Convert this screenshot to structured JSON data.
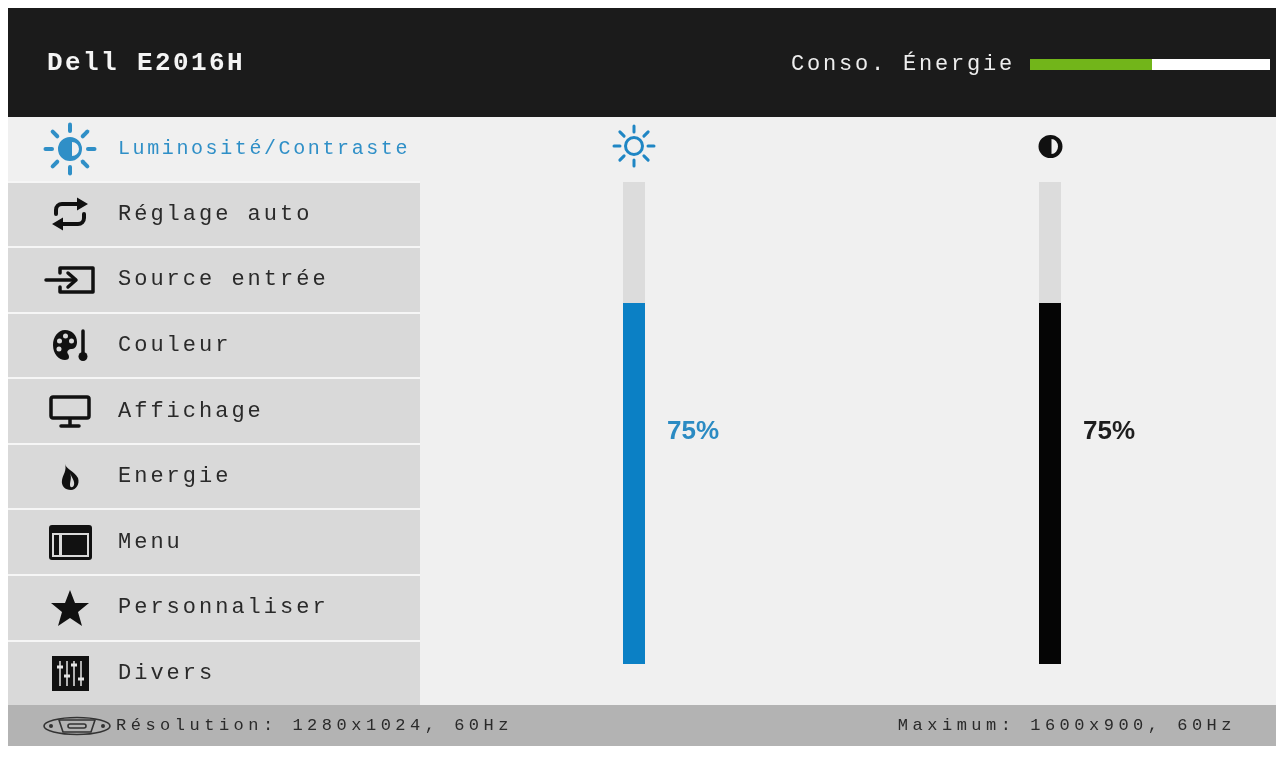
{
  "header": {
    "title": "Dell E2016H",
    "power": {
      "label": "Conso. Énergie",
      "level": 0.51
    }
  },
  "menu": {
    "items": [
      {
        "label": "Luminosité/Contraste",
        "selected": true
      },
      {
        "label": "Réglage auto",
        "selected": false
      },
      {
        "label": "Source entrée",
        "selected": false
      },
      {
        "label": "Couleur",
        "selected": false
      },
      {
        "label": "Affichage",
        "selected": false
      },
      {
        "label": "Energie",
        "selected": false
      },
      {
        "label": "Menu",
        "selected": false
      },
      {
        "label": "Personnaliser",
        "selected": false
      },
      {
        "label": "Divers",
        "selected": false
      }
    ]
  },
  "adjustments": [
    {
      "kind": "brightness",
      "level": 0.75,
      "reading": "75%"
    },
    {
      "kind": "contrast",
      "level": 0.75,
      "reading": "75%"
    }
  ],
  "status_bar": {
    "resolution": "Résolution: 1280x1024, 60Hz",
    "maximum": "Maximum: 1600x900, 60Hz"
  }
}
